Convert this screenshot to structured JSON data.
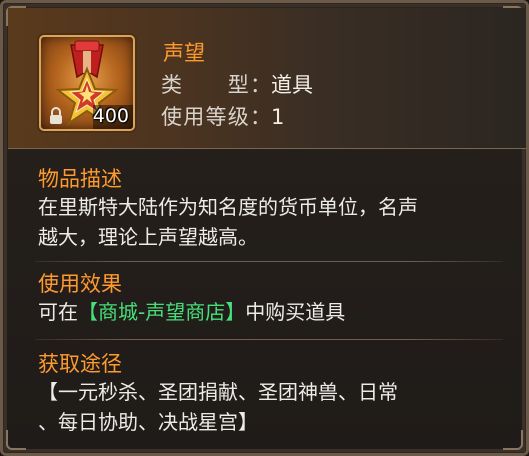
{
  "item": {
    "name": "声望",
    "type_label": "类　　型：",
    "type_value": "道具",
    "level_label": "使用等级：",
    "level_value": "1",
    "quantity": "400",
    "icon": "medal-icon"
  },
  "sections": {
    "description": {
      "title": "物品描述",
      "line1": "在里斯特大陆作为知名度的货币单位，名声",
      "line2": "越大，理论上声望越高。"
    },
    "effect": {
      "title": "使用效果",
      "prefix": "可在",
      "link": "【商城-声望商店】",
      "suffix": "中购买道具"
    },
    "source": {
      "title": "获取途径",
      "line1": "【一元秒杀、圣团捐献、圣团神兽、日常",
      "line2": "、每日协助、决战星宫】"
    }
  },
  "colors": {
    "accent": "#ff9a2e",
    "highlight": "#46e07a",
    "text": "#ecebe8"
  }
}
